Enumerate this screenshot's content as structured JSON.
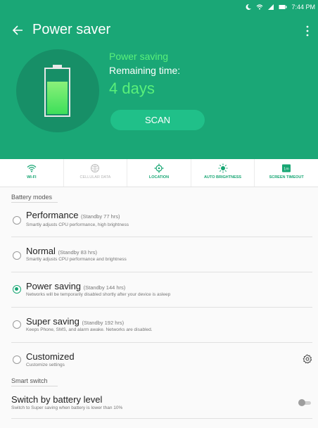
{
  "status_bar": {
    "time": "7:44 PM"
  },
  "app": {
    "title": "Power saver"
  },
  "summary": {
    "mode_label": "Power saving",
    "remaining_label": "Remaining time:",
    "remaining_value": "4 days",
    "scan_label": "SCAN"
  },
  "quick_settings": [
    {
      "label": "WI-FI",
      "icon": "wifi-icon",
      "active": true
    },
    {
      "label": "CELLULAR DATA",
      "icon": "cellular-data-icon",
      "active": false
    },
    {
      "label": "LOCATION",
      "icon": "location-icon",
      "active": true
    },
    {
      "label": "AUTO BRIGHTNESS",
      "icon": "brightness-icon",
      "active": true
    },
    {
      "label": "SCREEN TIMEOUT",
      "icon": "screen-timeout-icon",
      "badge": "1m",
      "active": true
    }
  ],
  "battery_modes": {
    "header": "Battery modes",
    "items": [
      {
        "title": "Performance",
        "standby": "(Standby 77 hrs)",
        "subtitle": "Smartly adjusts CPU performance, high brightness",
        "selected": false
      },
      {
        "title": "Normal",
        "standby": "(Standby 83 hrs)",
        "subtitle": "Smartly adjusts CPU performance and brightness",
        "selected": false
      },
      {
        "title": "Power saving",
        "standby": "(Standby 144 hrs)",
        "subtitle": "Networks will be temporarily disabled shortly after your device is asleep",
        "selected": true
      },
      {
        "title": "Super saving",
        "standby": "(Standby 192 hrs)",
        "subtitle": "Keeps Phone, SMS, and alarm awake. Networks are disabled.",
        "selected": false
      },
      {
        "title": "Customized",
        "standby": "",
        "subtitle": "Customize settings",
        "selected": false
      }
    ]
  },
  "smart_switch": {
    "header": "Smart switch",
    "title": "Switch by battery level",
    "subtitle": "Switch to Super saving when battery is lower than 10%",
    "enabled": false
  },
  "colors": {
    "header_green": "#1aa776",
    "accent_green": "#59f07a",
    "active_label": "#17a673"
  }
}
